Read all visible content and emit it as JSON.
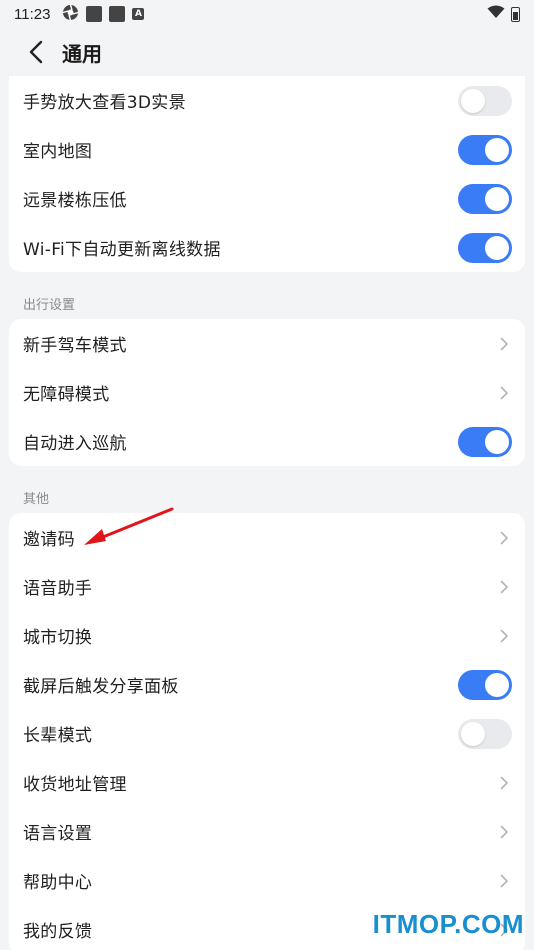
{
  "status_bar": {
    "time": "11:23",
    "icons": [
      "aperture-icon",
      "square-icon",
      "square-icon",
      "a-badge-icon"
    ],
    "a_badge_text": "A",
    "right_icons": [
      "wifi-icon",
      "battery-icon"
    ]
  },
  "header": {
    "title": "通用",
    "back_icon": "chevron-left-icon"
  },
  "colors": {
    "toggle_on": "#3a7cf5",
    "toggle_off": "#e9eaed",
    "background": "#f3f4f6",
    "annotation_arrow": "#e0161b",
    "watermark": "#1a8fd0"
  },
  "sections": [
    {
      "header": "",
      "items": [
        {
          "label": "手势放大查看3D实景",
          "control": "toggle",
          "on": false
        },
        {
          "label": "室内地图",
          "control": "toggle",
          "on": true
        },
        {
          "label": "远景楼栋压低",
          "control": "toggle",
          "on": true
        },
        {
          "label": "Wi-Fi下自动更新离线数据",
          "control": "toggle",
          "on": true
        }
      ]
    },
    {
      "header": "出行设置",
      "items": [
        {
          "label": "新手驾车模式",
          "control": "chevron"
        },
        {
          "label": "无障碍模式",
          "control": "chevron"
        },
        {
          "label": "自动进入巡航",
          "control": "toggle",
          "on": true
        }
      ]
    },
    {
      "header": "其他",
      "items": [
        {
          "label": "邀请码",
          "control": "chevron"
        },
        {
          "label": "语音助手",
          "control": "chevron"
        },
        {
          "label": "城市切换",
          "control": "chevron"
        },
        {
          "label": "截屏后触发分享面板",
          "control": "toggle",
          "on": true
        },
        {
          "label": "长辈模式",
          "control": "toggle",
          "on": false
        },
        {
          "label": "收货地址管理",
          "control": "chevron"
        },
        {
          "label": "语言设置",
          "control": "chevron"
        },
        {
          "label": "帮助中心",
          "control": "chevron"
        },
        {
          "label": "我的反馈",
          "control": "chevron"
        }
      ]
    }
  ],
  "watermark": "ITMOP.COM"
}
